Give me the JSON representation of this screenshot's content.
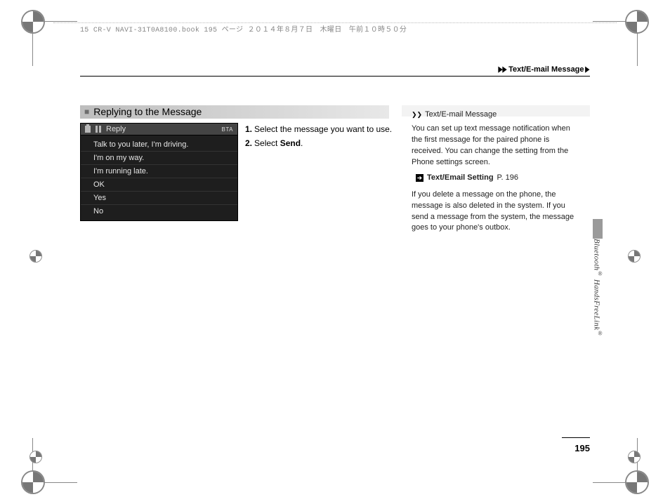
{
  "stamp": "15 CR-V NAVI-31T0A8100.book  195 ページ   ２０１４年８月７日　木曜日　午前１０時５０分",
  "breadcrumb": {
    "arrows": "▶▶",
    "text": "Text/E-mail Message",
    "trail": "▶"
  },
  "section_title": "Replying to the Message",
  "reply_screen": {
    "header_label": "Reply",
    "bt_indicator": "BTA",
    "items": [
      "Talk to you later, I'm driving.",
      "I'm on my way.",
      "I'm running late.",
      "OK",
      "Yes",
      "No"
    ]
  },
  "steps": [
    {
      "n": "1.",
      "text": "Select the message you want to use."
    },
    {
      "n": "2.",
      "prefix": "Select ",
      "bold": "Send",
      "suffix": "."
    }
  ],
  "info": {
    "title": "Text/E-mail Message",
    "para1": "You can set up text message notification when the first message for the paired phone is received. You can change the setting from the Phone settings screen.",
    "ref_label": "Text/Email Setting",
    "ref_page": "P. 196",
    "para2": "If you delete a message on the phone, the message is also deleted in the system. If you send a message from the system, the message goes to your phone's outbox."
  },
  "side_label": {
    "a": "Bluetooth",
    "reg1": "®",
    "b": " HandsFreeLink",
    "reg2": "®"
  },
  "page_number": "195"
}
